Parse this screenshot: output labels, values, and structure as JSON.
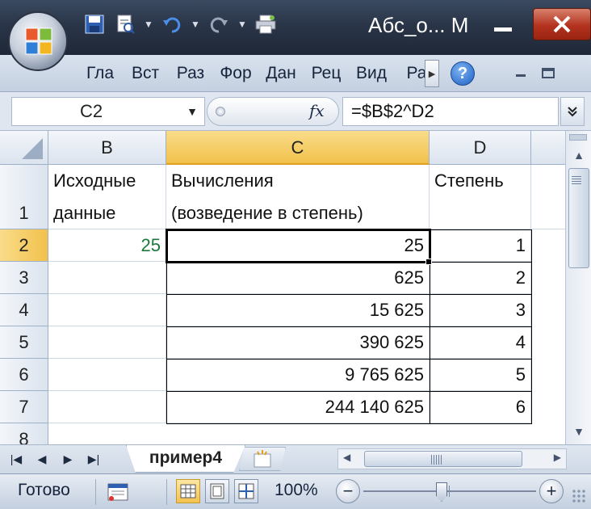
{
  "window": {
    "title": "Абс_о... М",
    "minimize_icon": "minimize-icon",
    "close_icon": "close-icon"
  },
  "quick_access": {
    "icons": [
      "save-icon",
      "print-preview-icon",
      "undo-icon",
      "redo-icon",
      "printer-icon"
    ]
  },
  "ribbon": {
    "tabs": [
      "Гла",
      "Вст",
      "Раз",
      "Фор",
      "Дан",
      "Рец",
      "Вид",
      "Ра"
    ],
    "help_label": "?"
  },
  "formula_bar": {
    "name_box": "C2",
    "fx_label": "fx",
    "formula": "=$B$2^D2"
  },
  "columns": [
    "B",
    "C",
    "D"
  ],
  "rows": [
    "1",
    "2",
    "3",
    "4",
    "5",
    "6",
    "7",
    "8"
  ],
  "cells": {
    "B1": [
      "Исходные",
      "данные"
    ],
    "C1": [
      "Вычисления",
      "(возведение в степень)"
    ],
    "D1": "Степень",
    "B2": "25",
    "C": [
      "25",
      "625",
      "15 625",
      "390 625",
      "9 765 625",
      "244 140 625"
    ],
    "D": [
      "1",
      "2",
      "3",
      "4",
      "5",
      "6"
    ]
  },
  "selection": {
    "cell": "C2"
  },
  "sheet_tabs": [
    "пример4"
  ],
  "status": {
    "text": "Готово",
    "zoom": "100%",
    "zoom_minus": "−",
    "zoom_plus": "+"
  },
  "colors": {
    "title_bg": "#2a3548",
    "active_header": "#f2c14b",
    "green_value": "#1a7a3a"
  }
}
